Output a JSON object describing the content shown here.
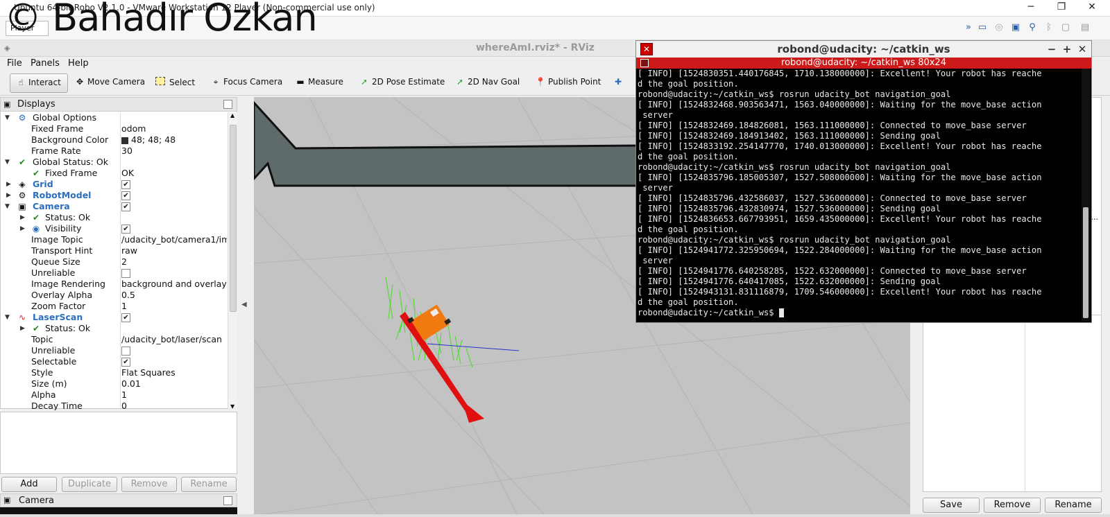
{
  "watermark": "© Bahadır Özkan",
  "vm": {
    "title": "Ubuntu 64-bit Robo V2.1.0 - VMware Workstation 12 Player (Non-commercial use only)",
    "player_label": "Player"
  },
  "rviz": {
    "title": "whereAmI.rviz* - RViz",
    "menu": [
      "File",
      "Panels",
      "Help"
    ],
    "toolbar": {
      "interact": "Interact",
      "move_camera": "Move Camera",
      "select": "Select",
      "focus_camera": "Focus Camera",
      "measure": "Measure",
      "pose_estimate": "2D Pose Estimate",
      "nav_goal": "2D Nav Goal",
      "publish_point": "Publish Point"
    },
    "displays": {
      "title": "Displays",
      "global_options": "Global Options",
      "fixed_frame_label": "Fixed Frame",
      "fixed_frame_value": "odom",
      "bg_color_label": "Background Color",
      "bg_color_value": "48; 48; 48",
      "frame_rate_label": "Frame Rate",
      "frame_rate_value": "30",
      "global_status": "Global Status: Ok",
      "gs_fixed_frame_label": "Fixed Frame",
      "gs_fixed_frame_value": "OK",
      "grid": "Grid",
      "robot_model": "RobotModel",
      "camera": "Camera",
      "cam_status": "Status: Ok",
      "visibility": "Visibility",
      "image_topic_label": "Image Topic",
      "image_topic_value": "/udacity_bot/camera1/im...",
      "transport_label": "Transport Hint",
      "transport_value": "raw",
      "queue_label": "Queue Size",
      "queue_value": "2",
      "unreliable_label": "Unreliable",
      "rendering_label": "Image Rendering",
      "rendering_value": "background and overlay",
      "overlay_label": "Overlay Alpha",
      "overlay_value": "0.5",
      "zoom_label": "Zoom Factor",
      "zoom_value": "1",
      "laserscan": "LaserScan",
      "ls_status": "Status: Ok",
      "topic_label": "Topic",
      "topic_value": "/udacity_bot/laser/scan",
      "ls_unreliable_label": "Unreliable",
      "selectable_label": "Selectable",
      "style_label": "Style",
      "style_value": "Flat Squares",
      "size_label": "Size (m)",
      "size_value": "0.01",
      "alpha_label": "Alpha",
      "alpha_value": "1",
      "decay_label": "Decay Time",
      "decay_value": "0"
    },
    "buttons": {
      "add": "Add",
      "duplicate": "Duplicate",
      "remove": "Remove",
      "rename": "Rename"
    },
    "camera_panel": "Camera",
    "right_buttons": {
      "save": "Save",
      "remove": "Remove",
      "rename": "Rename"
    },
    "right_ellipsis": "-..."
  },
  "terminal": {
    "title": "robond@udacity: ~/catkin_ws",
    "tab": "robond@udacity: ~/catkin_ws 80x24",
    "lines": [
      "[ INFO] [1524830351.440176845, 1710.138000000]: Excellent! Your robot has reache",
      "d the goal position.",
      "robond@udacity:~/catkin_ws$ rosrun udacity_bot navigation_goal",
      "[ INFO] [1524832468.903563471, 1563.040000000]: Waiting for the move_base action",
      " server",
      "[ INFO] [1524832469.184826081, 1563.111000000]: Connected to move_base server",
      "[ INFO] [1524832469.184913402, 1563.111000000]: Sending goal",
      "[ INFO] [1524833192.254147770, 1740.013000000]: Excellent! Your robot has reache",
      "d the goal position.",
      "robond@udacity:~/catkin_ws$ rosrun udacity_bot navigation_goal",
      "[ INFO] [1524835796.185005307, 1527.508000000]: Waiting for the move_base action",
      " server",
      "[ INFO] [1524835796.432586037, 1527.536000000]: Connected to move_base server",
      "[ INFO] [1524835796.432830974, 1527.536000000]: Sending goal",
      "[ INFO] [1524836653.667793951, 1659.435000000]: Excellent! Your robot has reache",
      "d the goal position.",
      "robond@udacity:~/catkin_ws$ rosrun udacity_bot navigation_goal",
      "[ INFO] [1524941772.325950694, 1522.284000000]: Waiting for the move_base action",
      " server",
      "[ INFO] [1524941776.640258285, 1522.632000000]: Connected to move_base server",
      "[ INFO] [1524941776.640417085, 1522.632000000]: Sending goal",
      "[ INFO] [1524943131.831116879, 1709.546000000]: Excellent! Your robot has reache",
      "d the goal position.",
      "robond@udacity:~/catkin_ws$ "
    ]
  },
  "colors": {
    "terminal_tab": "#cc1a1a",
    "viewport_bg": "#c3c3c3",
    "map_corridor": "#5f6b6b",
    "robot": "#f07a10",
    "pose_arrow": "#e01010",
    "particles": "#44dd22",
    "link_blue": "#2a6ebd"
  }
}
